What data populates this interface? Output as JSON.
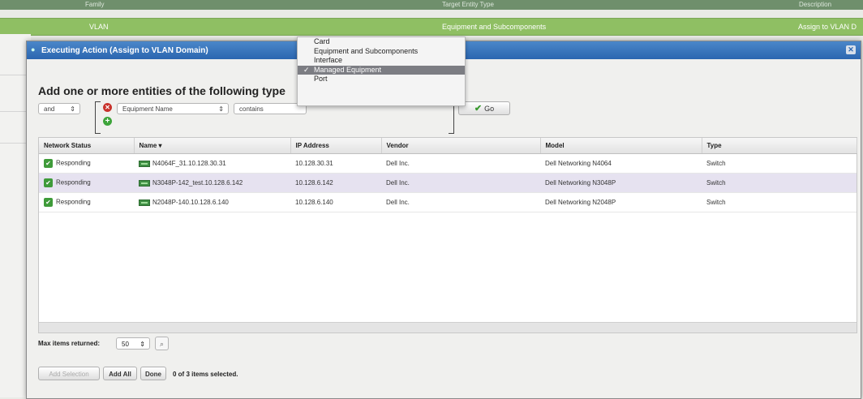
{
  "background": {
    "header_labels": [
      "Family",
      "Target Entity Type",
      "Description"
    ],
    "row": {
      "family": "VLAN",
      "target_type": "Equipment and Subcomponents",
      "description": "Assign to VLAN D"
    }
  },
  "dialog": {
    "title": "Executing Action (Assign to VLAN Domain)",
    "heading": "Add one or more entities of the following type",
    "filter": {
      "logic_value": "and",
      "field_value": "Equipment Name",
      "operator_value": "contains",
      "go_label": "Go"
    },
    "type_dropdown": {
      "options": [
        "Card",
        "Equipment and Subcomponents",
        "Interface",
        "Managed Equipment",
        "Port"
      ],
      "selected": "Managed Equipment"
    },
    "table": {
      "columns": [
        "Network Status",
        "Name",
        "IP Address",
        "Vendor",
        "Model",
        "Type"
      ],
      "rows": [
        {
          "status": "Responding",
          "name": "N4064F_31.10.128.30.31",
          "ip": "10.128.30.31",
          "vendor": "Dell Inc.",
          "model": "Dell Networking N4064",
          "type": "Switch"
        },
        {
          "status": "Responding",
          "name": "N3048P-142_test.10.128.6.142",
          "ip": "10.128.6.142",
          "vendor": "Dell Inc.",
          "model": "Dell Networking N3048P",
          "type": "Switch"
        },
        {
          "status": "Responding",
          "name": "N2048P-140.10.128.6.140",
          "ip": "10.128.6.140",
          "vendor": "Dell Inc.",
          "model": "Dell Networking N2048P",
          "type": "Switch"
        }
      ],
      "selected_row": 1
    },
    "max_items_label": "Max items returned:",
    "max_items_value": "50",
    "buttons": {
      "add_selection": "Add Selection",
      "add_all": "Add All",
      "done": "Done"
    },
    "selection_status": "0 of 3 items selected."
  },
  "colors": {
    "title_bar": "#2b66b0",
    "bg_row": "#8fbf63",
    "selected_row": "#e6e2f0",
    "status_green": "#3f9b3a"
  }
}
